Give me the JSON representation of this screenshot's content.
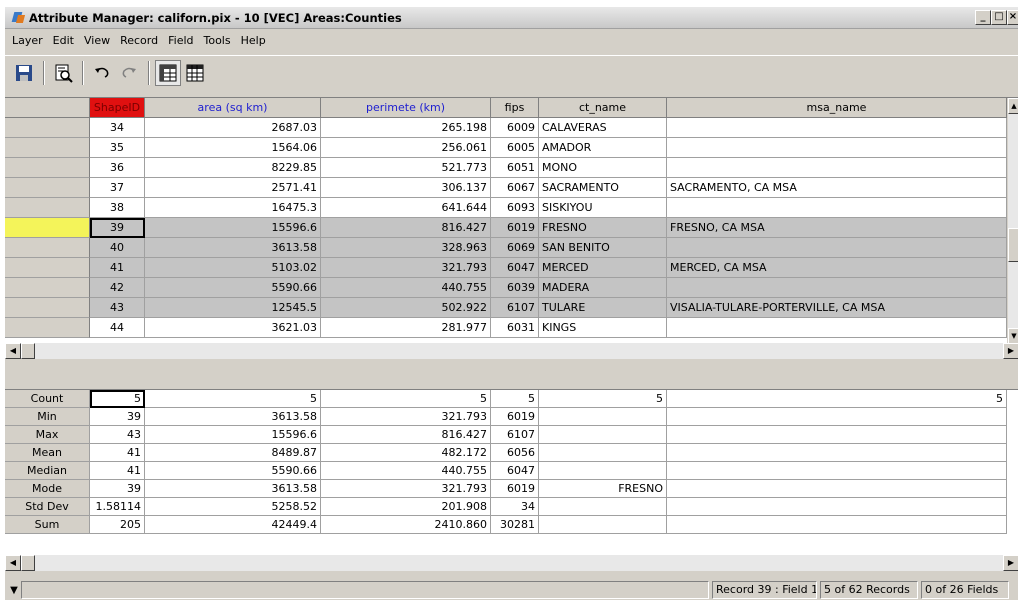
{
  "window": {
    "title": "Attribute Manager: californ.pix - 10 [VEC] Areas:Counties"
  },
  "window_buttons": {
    "minimize": "_",
    "maximize": "□",
    "close": "×"
  },
  "menu": [
    "Layer",
    "Edit",
    "View",
    "Record",
    "Field",
    "Tools",
    "Help"
  ],
  "toolbar": [
    "save-icon",
    "print-preview-icon",
    "undo-icon",
    "redo-icon",
    "select-grid-icon",
    "table-icon"
  ],
  "grid": {
    "columns": [
      "ShapeID",
      "area (sq km)",
      "perimete (km)",
      "fips",
      "ct_name",
      "msa_name"
    ],
    "rows": [
      [
        "34",
        "2687.03",
        "265.198",
        "6009",
        "CALAVERAS",
        ""
      ],
      [
        "35",
        "1564.06",
        "256.061",
        "6005",
        "AMADOR",
        ""
      ],
      [
        "36",
        "8229.85",
        "521.773",
        "6051",
        "MONO",
        ""
      ],
      [
        "37",
        "2571.41",
        "306.137",
        "6067",
        "SACRAMENTO",
        "SACRAMENTO, CA MSA"
      ],
      [
        "38",
        "16475.3",
        "641.644",
        "6093",
        "SISKIYOU",
        ""
      ],
      [
        "39",
        "15596.6",
        "816.427",
        "6019",
        "FRESNO",
        "FRESNO, CA MSA"
      ],
      [
        "40",
        "3613.58",
        "328.963",
        "6069",
        "SAN BENITO",
        ""
      ],
      [
        "41",
        "5103.02",
        "321.793",
        "6047",
        "MERCED",
        "MERCED, CA MSA"
      ],
      [
        "42",
        "5590.66",
        "440.755",
        "6039",
        "MADERA",
        ""
      ],
      [
        "43",
        "12545.5",
        "502.922",
        "6107",
        "TULARE",
        "VISALIA-TULARE-PORTERVILLE, CA MSA"
      ],
      [
        "44",
        "3621.03",
        "281.977",
        "6031",
        "KINGS",
        ""
      ]
    ]
  },
  "stats": {
    "rows": [
      {
        "label": "Count",
        "values": [
          "5",
          "5",
          "5",
          "5",
          "5",
          "5"
        ]
      },
      {
        "label": "Min",
        "values": [
          "39",
          "3613.58",
          "321.793",
          "6019",
          "",
          ""
        ]
      },
      {
        "label": "Max",
        "values": [
          "43",
          "15596.6",
          "816.427",
          "6107",
          "",
          ""
        ]
      },
      {
        "label": "Mean",
        "values": [
          "41",
          "8489.87",
          "482.172",
          "6056",
          "",
          ""
        ]
      },
      {
        "label": "Median",
        "values": [
          "41",
          "5590.66",
          "440.755",
          "6047",
          "",
          ""
        ]
      },
      {
        "label": "Mode",
        "values": [
          "39",
          "3613.58",
          "321.793",
          "6019",
          "FRESNO",
          ""
        ]
      },
      {
        "label": "Std Dev",
        "values": [
          "1.58114",
          "5258.52",
          "201.908",
          "34",
          "",
          ""
        ]
      },
      {
        "label": "Sum",
        "values": [
          "205",
          "42449.4",
          "2410.860",
          "30281",
          "",
          ""
        ]
      }
    ]
  },
  "status": {
    "record": "Record 39 : Field 1",
    "records": "5 of 62 Records",
    "fields": "0 of 26 Fields"
  },
  "colors": {
    "highlight_row_header": "#f4f45a",
    "shapeid_header": "#e01010",
    "column_header_text": "#2020d0"
  }
}
